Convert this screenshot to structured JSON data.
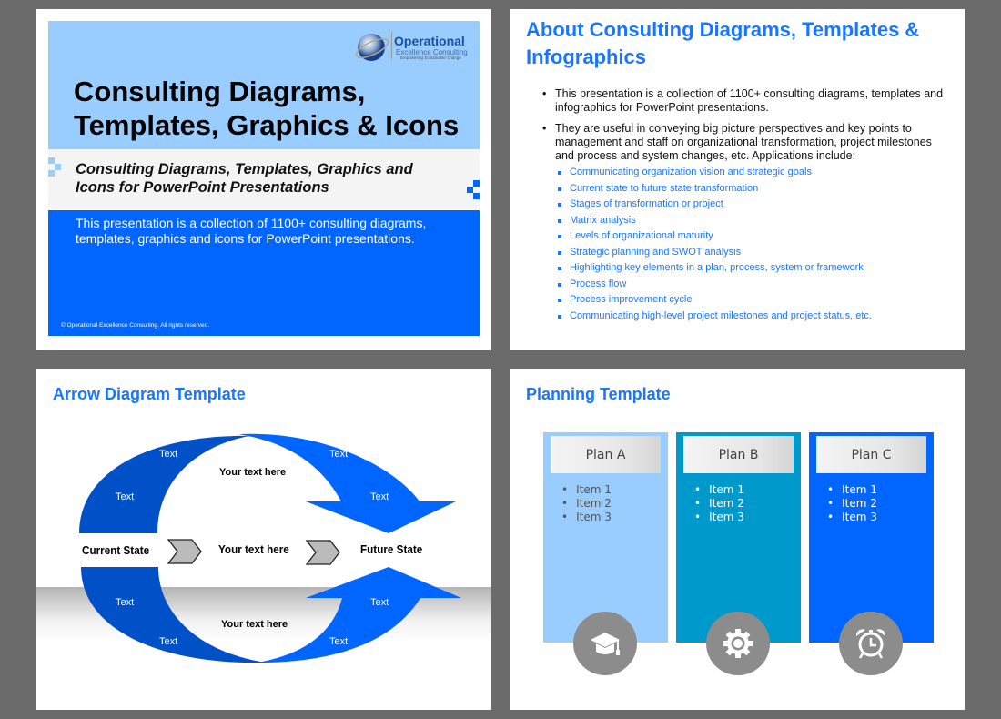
{
  "slide1": {
    "logo": {
      "name": "Operational",
      "line2": "Excellence Consulting",
      "tagline": "Empowering Sustainable Change"
    },
    "title_line1": "Consulting Diagrams,",
    "title_line2": "Templates, Graphics & Icons",
    "subtitle_line1": "Consulting Diagrams, Templates, Graphics and",
    "subtitle_line2": "Icons for PowerPoint Presentations",
    "description_line1": "This presentation is a collection of 1100+ consulting diagrams,",
    "description_line2": "templates, graphics and icons for PowerPoint presentations.",
    "copyright": "© Operational Excellence Consulting.  All rights reserved.",
    "colors": {
      "light_blue": "#99ccff",
      "blue": "#0066ff",
      "grey": "#f4f4f4"
    }
  },
  "slide2": {
    "title": "About Consulting Diagrams, Templates & Infographics",
    "bullets": [
      "This presentation is a collection of 1100+ consulting diagrams, templates and infographics for PowerPoint presentations.",
      "They are useful in conveying big picture perspectives and key points to management and staff on organizational transformation, project milestones and process and system changes, etc.  Applications include:"
    ],
    "applications": [
      "Communicating organization vision and strategic goals",
      "Current state to future state transformation",
      "Stages of transformation or project",
      "Matrix analysis",
      "Levels of organizational maturity",
      "Strategic planning and SWOT analysis",
      "Highlighting key elements in a plan, process, system or framework",
      "Process flow",
      "Process improvement cycle",
      "Communicating high-level project milestones and project status, etc."
    ]
  },
  "slide3": {
    "title": "Arrow Diagram Template",
    "arrow_labels": [
      "Text",
      "Text",
      "Text",
      "Text",
      "Text",
      "Text",
      "Text",
      "Text"
    ],
    "top_text": "Your text here",
    "center_text": "Your text here",
    "bottom_text": "Your text here",
    "current_state": "Current State",
    "future_state": "Future State",
    "colors": {
      "dark_blue": "#0050c8",
      "blue": "#0066ff"
    }
  },
  "slide4": {
    "title": "Planning Template",
    "plans": [
      {
        "label": "Plan A",
        "items": [
          "Item 1",
          "Item 2",
          "Item 3"
        ],
        "color": "#99ccff",
        "icon": "graduation-cap-icon"
      },
      {
        "label": "Plan B",
        "items": [
          "Item 1",
          "Item 2",
          "Item 3"
        ],
        "color": "#0099cc",
        "icon": "gear-icon"
      },
      {
        "label": "Plan C",
        "items": [
          "Item 1",
          "Item 2",
          "Item 3"
        ],
        "color": "#0066ff",
        "icon": "alarm-clock-icon"
      }
    ]
  }
}
